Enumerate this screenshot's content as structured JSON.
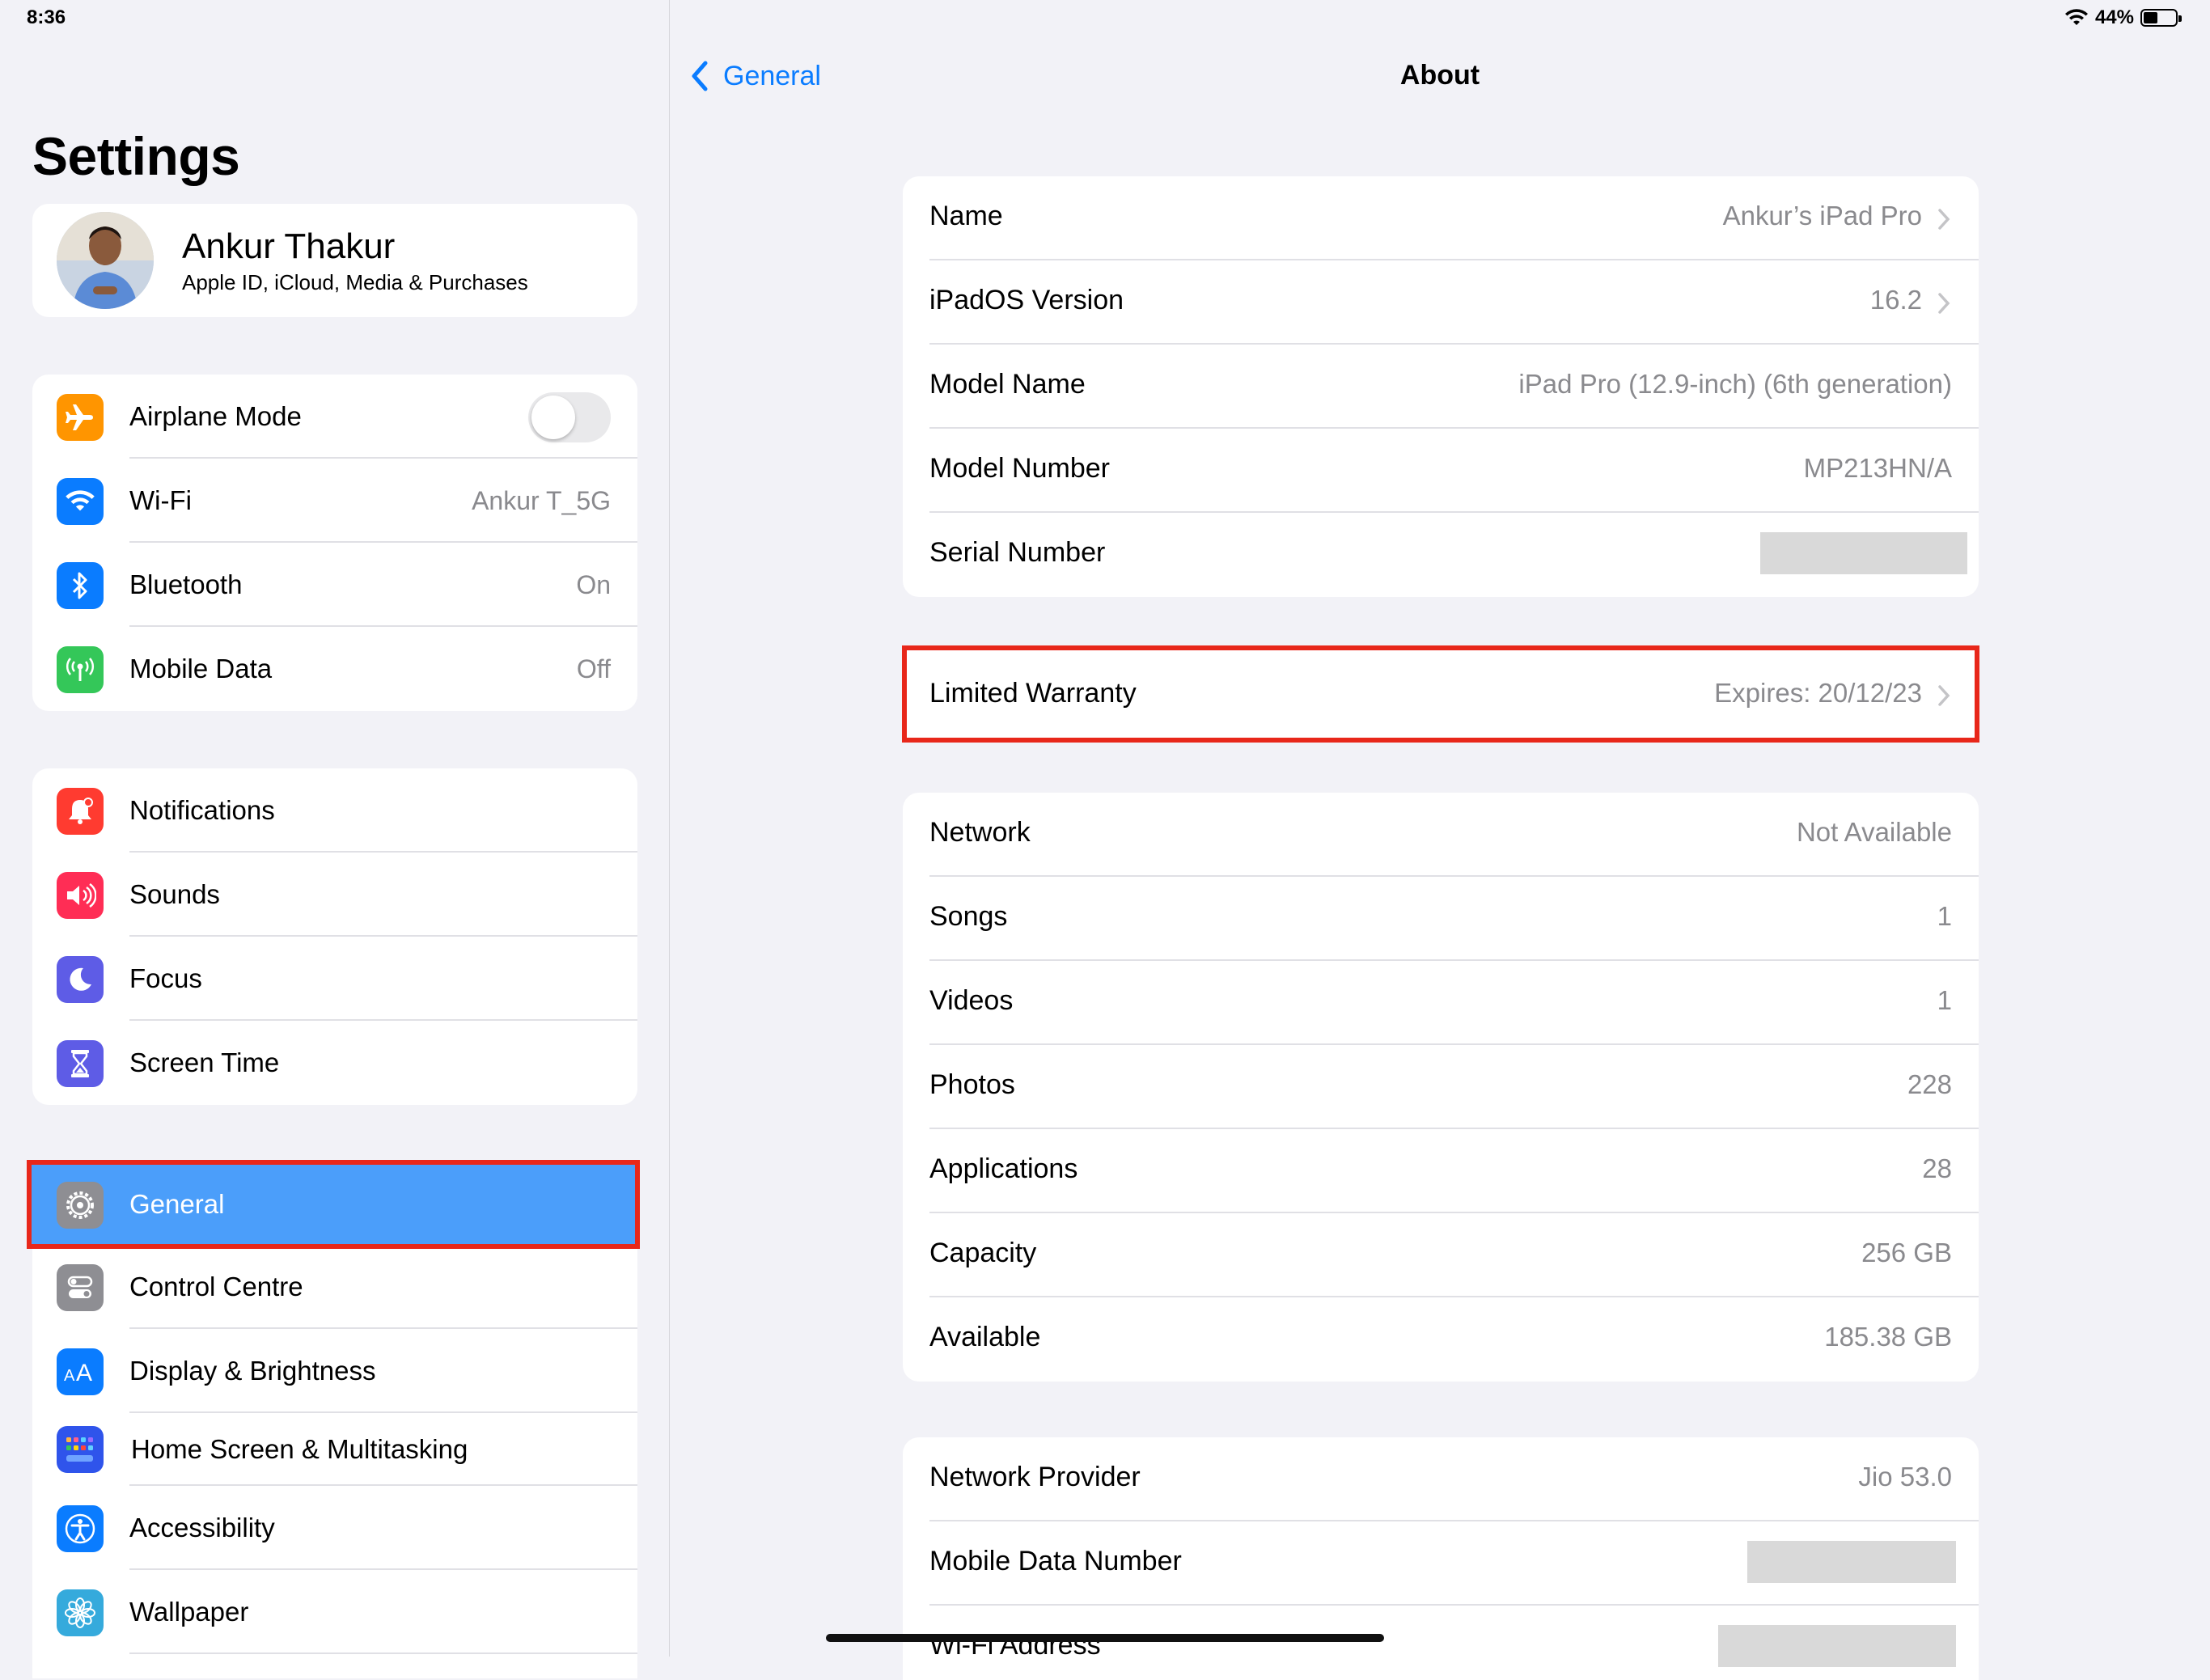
{
  "status": {
    "time": "8:36",
    "battery": "44%",
    "battery_level": 0.44
  },
  "sidebar": {
    "title": "Settings",
    "profile": {
      "name": "Ankur Thakur",
      "subtitle": "Apple ID, iCloud, Media & Purchases"
    },
    "group1": [
      {
        "label": "Airplane Mode",
        "icon": "airplane-icon",
        "color": "#ff9500",
        "toggle": false
      },
      {
        "label": "Wi-Fi",
        "value": "Ankur T_5G",
        "icon": "wifi-icon",
        "color": "#0a7cff"
      },
      {
        "label": "Bluetooth",
        "value": "On",
        "icon": "bluetooth-icon",
        "color": "#0a7cff"
      },
      {
        "label": "Mobile Data",
        "value": "Off",
        "icon": "antenna-icon",
        "color": "#34c759"
      }
    ],
    "group2": [
      {
        "label": "Notifications",
        "icon": "bell-icon",
        "color": "#ff3b30"
      },
      {
        "label": "Sounds",
        "icon": "speaker-icon",
        "color": "#ff2d55"
      },
      {
        "label": "Focus",
        "icon": "moon-icon",
        "color": "#5e5ce6"
      },
      {
        "label": "Screen Time",
        "icon": "hourglass-icon",
        "color": "#5e5ce6"
      }
    ],
    "group3": [
      {
        "label": "General",
        "icon": "gear-icon",
        "color": "#8e8e93",
        "selected": true
      },
      {
        "label": "Control Centre",
        "icon": "switches-icon",
        "color": "#8e8e93"
      },
      {
        "label": "Display & Brightness",
        "icon": "text-size-icon",
        "color": "#0a7cff"
      },
      {
        "label": "Home Screen & Multitasking",
        "icon": "grid-icon",
        "color": "#2f54eb"
      },
      {
        "label": "Accessibility",
        "icon": "accessibility-icon",
        "color": "#0a7cff"
      },
      {
        "label": "Wallpaper",
        "icon": "flower-icon",
        "color": "#35aadc"
      }
    ]
  },
  "detail": {
    "back_label": "General",
    "title": "About",
    "section1": [
      {
        "label": "Name",
        "value": "Ankur’s iPad Pro",
        "chevron": true
      },
      {
        "label": "iPadOS Version",
        "value": "16.2",
        "chevron": true
      },
      {
        "label": "Model Name",
        "value": "iPad Pro (12.9-inch) (6th generation)"
      },
      {
        "label": "Model Number",
        "value": "MP213HN/A"
      },
      {
        "label": "Serial Number",
        "value": ""
      }
    ],
    "warranty": {
      "label": "Limited Warranty",
      "value": "Expires: 20/12/23"
    },
    "section3": [
      {
        "label": "Network",
        "value": "Not Available"
      },
      {
        "label": "Songs",
        "value": "1"
      },
      {
        "label": "Videos",
        "value": "1"
      },
      {
        "label": "Photos",
        "value": "228"
      },
      {
        "label": "Applications",
        "value": "28"
      },
      {
        "label": "Capacity",
        "value": "256 GB"
      },
      {
        "label": "Available",
        "value": "185.38 GB"
      }
    ],
    "section4": [
      {
        "label": "Network Provider",
        "value": "Jio 53.0"
      },
      {
        "label": "Mobile Data Number",
        "value": ""
      },
      {
        "label": "Wi-Fi Address",
        "value": ""
      }
    ]
  },
  "colors": {
    "accent": "#0a7cff",
    "highlight": "#e8271a",
    "selected": "#4b9efa"
  }
}
